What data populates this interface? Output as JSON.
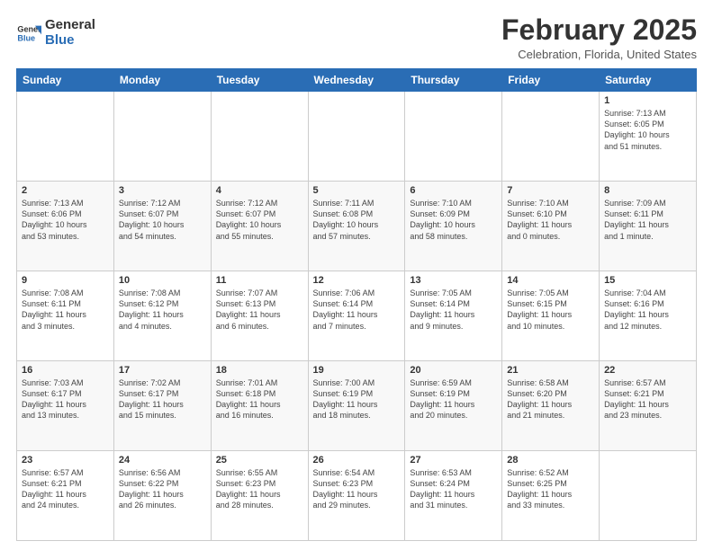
{
  "header": {
    "logo_general": "General",
    "logo_blue": "Blue",
    "month_title": "February 2025",
    "location": "Celebration, Florida, United States"
  },
  "weekdays": [
    "Sunday",
    "Monday",
    "Tuesday",
    "Wednesday",
    "Thursday",
    "Friday",
    "Saturday"
  ],
  "weeks": [
    [
      {
        "day": "",
        "info": ""
      },
      {
        "day": "",
        "info": ""
      },
      {
        "day": "",
        "info": ""
      },
      {
        "day": "",
        "info": ""
      },
      {
        "day": "",
        "info": ""
      },
      {
        "day": "",
        "info": ""
      },
      {
        "day": "1",
        "info": "Sunrise: 7:13 AM\nSunset: 6:05 PM\nDaylight: 10 hours\nand 51 minutes."
      }
    ],
    [
      {
        "day": "2",
        "info": "Sunrise: 7:13 AM\nSunset: 6:06 PM\nDaylight: 10 hours\nand 53 minutes."
      },
      {
        "day": "3",
        "info": "Sunrise: 7:12 AM\nSunset: 6:07 PM\nDaylight: 10 hours\nand 54 minutes."
      },
      {
        "day": "4",
        "info": "Sunrise: 7:12 AM\nSunset: 6:07 PM\nDaylight: 10 hours\nand 55 minutes."
      },
      {
        "day": "5",
        "info": "Sunrise: 7:11 AM\nSunset: 6:08 PM\nDaylight: 10 hours\nand 57 minutes."
      },
      {
        "day": "6",
        "info": "Sunrise: 7:10 AM\nSunset: 6:09 PM\nDaylight: 10 hours\nand 58 minutes."
      },
      {
        "day": "7",
        "info": "Sunrise: 7:10 AM\nSunset: 6:10 PM\nDaylight: 11 hours\nand 0 minutes."
      },
      {
        "day": "8",
        "info": "Sunrise: 7:09 AM\nSunset: 6:11 PM\nDaylight: 11 hours\nand 1 minute."
      }
    ],
    [
      {
        "day": "9",
        "info": "Sunrise: 7:08 AM\nSunset: 6:11 PM\nDaylight: 11 hours\nand 3 minutes."
      },
      {
        "day": "10",
        "info": "Sunrise: 7:08 AM\nSunset: 6:12 PM\nDaylight: 11 hours\nand 4 minutes."
      },
      {
        "day": "11",
        "info": "Sunrise: 7:07 AM\nSunset: 6:13 PM\nDaylight: 11 hours\nand 6 minutes."
      },
      {
        "day": "12",
        "info": "Sunrise: 7:06 AM\nSunset: 6:14 PM\nDaylight: 11 hours\nand 7 minutes."
      },
      {
        "day": "13",
        "info": "Sunrise: 7:05 AM\nSunset: 6:14 PM\nDaylight: 11 hours\nand 9 minutes."
      },
      {
        "day": "14",
        "info": "Sunrise: 7:05 AM\nSunset: 6:15 PM\nDaylight: 11 hours\nand 10 minutes."
      },
      {
        "day": "15",
        "info": "Sunrise: 7:04 AM\nSunset: 6:16 PM\nDaylight: 11 hours\nand 12 minutes."
      }
    ],
    [
      {
        "day": "16",
        "info": "Sunrise: 7:03 AM\nSunset: 6:17 PM\nDaylight: 11 hours\nand 13 minutes."
      },
      {
        "day": "17",
        "info": "Sunrise: 7:02 AM\nSunset: 6:17 PM\nDaylight: 11 hours\nand 15 minutes."
      },
      {
        "day": "18",
        "info": "Sunrise: 7:01 AM\nSunset: 6:18 PM\nDaylight: 11 hours\nand 16 minutes."
      },
      {
        "day": "19",
        "info": "Sunrise: 7:00 AM\nSunset: 6:19 PM\nDaylight: 11 hours\nand 18 minutes."
      },
      {
        "day": "20",
        "info": "Sunrise: 6:59 AM\nSunset: 6:19 PM\nDaylight: 11 hours\nand 20 minutes."
      },
      {
        "day": "21",
        "info": "Sunrise: 6:58 AM\nSunset: 6:20 PM\nDaylight: 11 hours\nand 21 minutes."
      },
      {
        "day": "22",
        "info": "Sunrise: 6:57 AM\nSunset: 6:21 PM\nDaylight: 11 hours\nand 23 minutes."
      }
    ],
    [
      {
        "day": "23",
        "info": "Sunrise: 6:57 AM\nSunset: 6:21 PM\nDaylight: 11 hours\nand 24 minutes."
      },
      {
        "day": "24",
        "info": "Sunrise: 6:56 AM\nSunset: 6:22 PM\nDaylight: 11 hours\nand 26 minutes."
      },
      {
        "day": "25",
        "info": "Sunrise: 6:55 AM\nSunset: 6:23 PM\nDaylight: 11 hours\nand 28 minutes."
      },
      {
        "day": "26",
        "info": "Sunrise: 6:54 AM\nSunset: 6:23 PM\nDaylight: 11 hours\nand 29 minutes."
      },
      {
        "day": "27",
        "info": "Sunrise: 6:53 AM\nSunset: 6:24 PM\nDaylight: 11 hours\nand 31 minutes."
      },
      {
        "day": "28",
        "info": "Sunrise: 6:52 AM\nSunset: 6:25 PM\nDaylight: 11 hours\nand 33 minutes."
      },
      {
        "day": "",
        "info": ""
      }
    ]
  ]
}
